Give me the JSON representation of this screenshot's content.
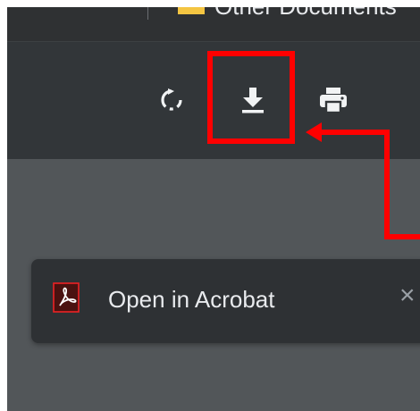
{
  "tab": {
    "title": "Other Documents",
    "folder_icon": "folder-icon"
  },
  "toolbar": {
    "rotate_icon": "rotate-icon",
    "download_icon": "download-icon",
    "print_icon": "print-icon"
  },
  "annotation": {
    "highlight_color": "#ff0000",
    "arrow_color": "#ff0000"
  },
  "toast": {
    "icon": "acrobat-icon",
    "label": "Open in Acrobat",
    "close_symbol": "×"
  },
  "colors": {
    "toolbar_bg": "#323639",
    "viewer_bg": "#525659",
    "toast_bg": "#2e3134",
    "acrobat_red": "#ed2224",
    "folder_yellow": "#f4c542"
  }
}
